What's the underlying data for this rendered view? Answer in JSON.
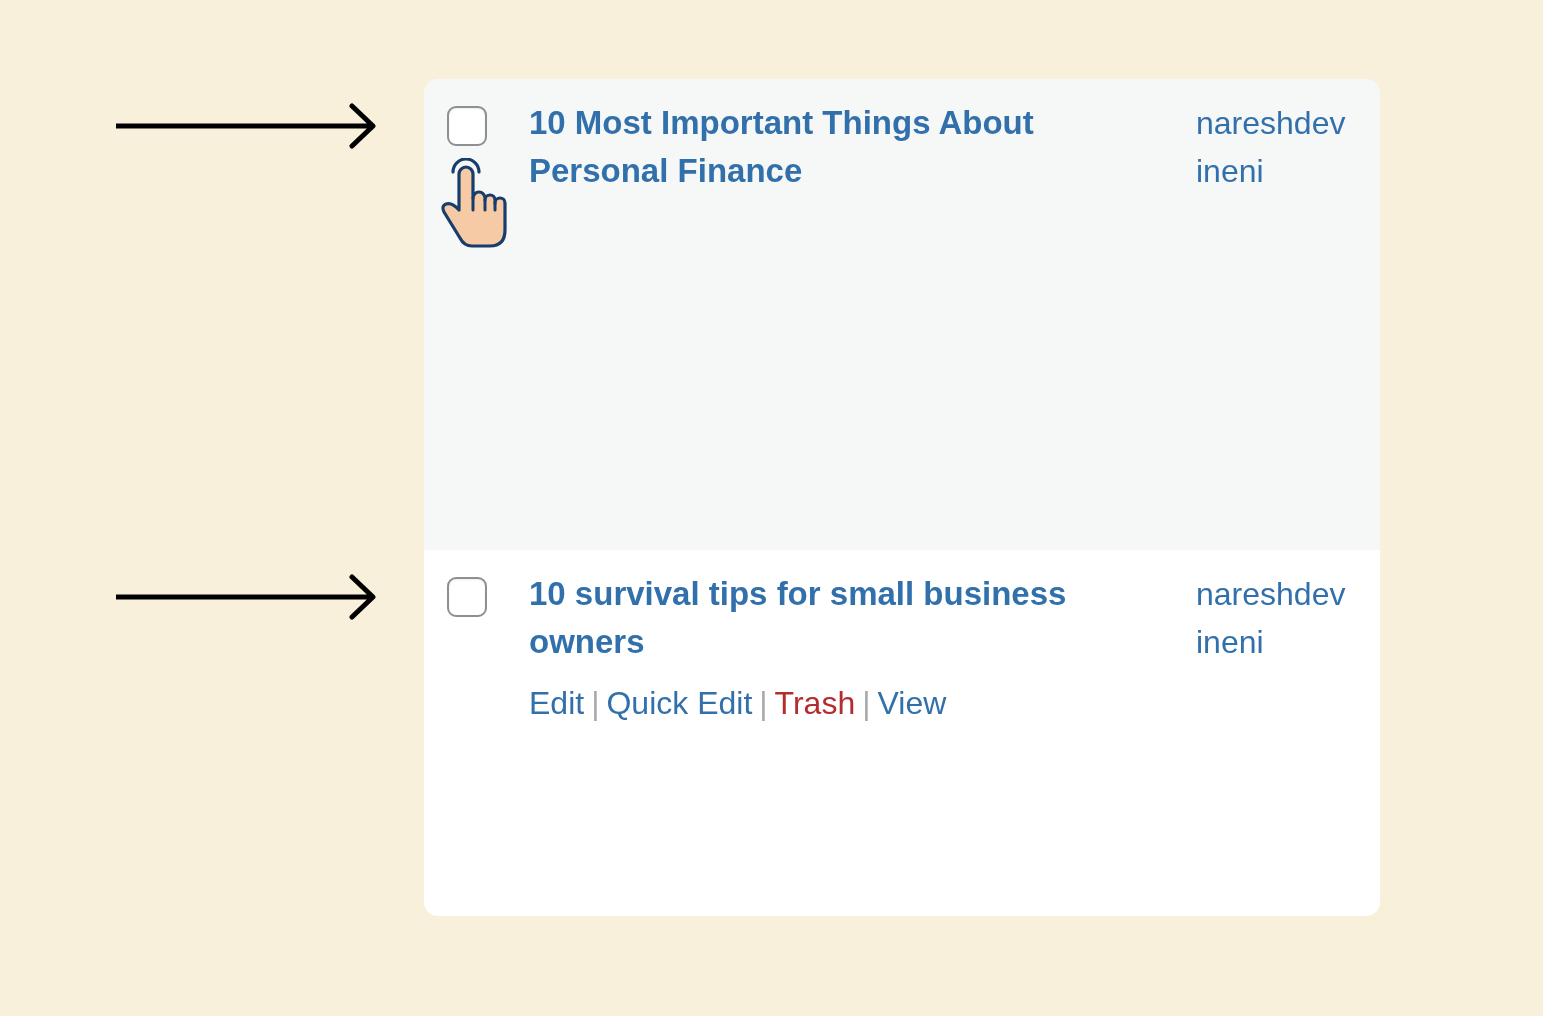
{
  "posts": [
    {
      "checked": false,
      "pointer": true,
      "title": "10 Most Important Things About Personal Finance",
      "author": "nareshdevineni"
    },
    {
      "checked": false,
      "pointer": false,
      "title": "10 survival tips for small business owners",
      "author": "nareshdevineni",
      "actions": [
        {
          "kind": "link",
          "label": "Edit"
        },
        {
          "kind": "separator",
          "label": "|"
        },
        {
          "kind": "link",
          "label": "Quick Edit"
        },
        {
          "kind": "separator",
          "label": "|"
        },
        {
          "kind": "delete",
          "label": "Trash"
        },
        {
          "kind": "separator",
          "label": "|"
        },
        {
          "kind": "link",
          "label": "View"
        }
      ]
    }
  ]
}
